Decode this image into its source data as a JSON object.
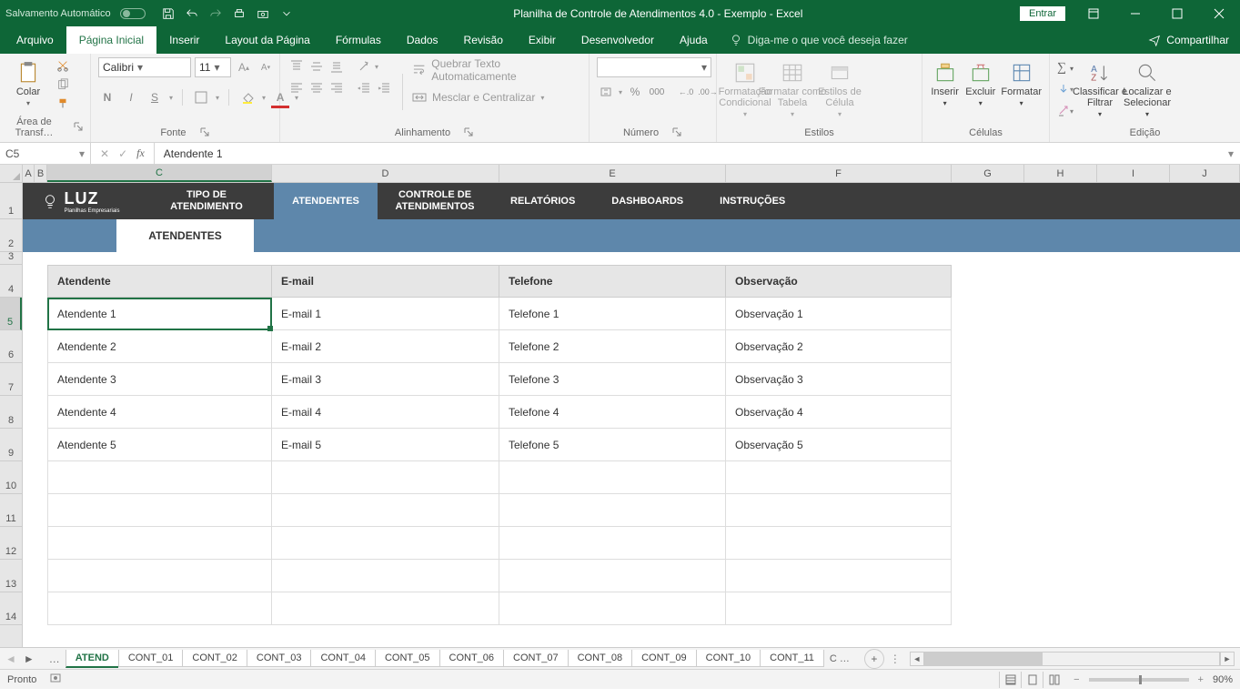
{
  "titlebar": {
    "autosave": "Salvamento Automático",
    "title": "Planilha de Controle de Atendimentos 4.0 - Exemplo  -  Excel",
    "login": "Entrar"
  },
  "tabs": {
    "arquivo": "Arquivo",
    "pagina_inicial": "Página Inicial",
    "inserir": "Inserir",
    "layout": "Layout da Página",
    "formulas": "Fórmulas",
    "dados": "Dados",
    "revisao": "Revisão",
    "exibir": "Exibir",
    "desenvolvedor": "Desenvolvedor",
    "ajuda": "Ajuda",
    "tell_me": "Diga-me o que você deseja fazer",
    "compartilhar": "Compartilhar"
  },
  "ribbon": {
    "clipboard": {
      "label": "Área de Transf…",
      "paste": "Colar"
    },
    "font": {
      "label": "Fonte",
      "name": "Calibri",
      "size": "11",
      "bold": "N",
      "italic": "I",
      "underline": "S"
    },
    "alignment": {
      "label": "Alinhamento",
      "wrap": "Quebrar Texto Automaticamente",
      "merge": "Mesclar e Centralizar"
    },
    "number": {
      "label": "Número",
      "percent": "%",
      "comma": "000",
      "dec_inc": ".0",
      "dec_dec": ".00"
    },
    "styles": {
      "label": "Estilos",
      "cond": "Formatação Condicional",
      "table": "Formatar como Tabela",
      "cell": "Estilos de Célula"
    },
    "cells": {
      "label": "Células",
      "insert": "Inserir",
      "delete": "Excluir",
      "format": "Formatar"
    },
    "editing": {
      "label": "Edição",
      "sort": "Classificar e Filtrar",
      "find": "Localizar e Selecionar"
    }
  },
  "formula": {
    "namebox": "C5",
    "value": "Atendente 1"
  },
  "columns": [
    "A",
    "B",
    "C",
    "D",
    "E",
    "F",
    "G",
    "H",
    "I",
    "J"
  ],
  "rows": [
    "1",
    "2",
    "3",
    "4",
    "5",
    "6",
    "7",
    "8",
    "9",
    "10",
    "11",
    "12",
    "13",
    "14"
  ],
  "sheetnav": {
    "brand": "LUZ",
    "brand_sub": "Planilhas Empresariais",
    "items": [
      "TIPO DE ATENDIMENTO",
      "ATENDENTES",
      "CONTROLE DE ATENDIMENTOS",
      "RELATÓRIOS",
      "DASHBOARDS",
      "INSTRUÇÕES"
    ],
    "subtab": "ATENDENTES"
  },
  "table": {
    "headers": [
      "Atendente",
      "E-mail",
      "Telefone",
      "Observação"
    ],
    "rows": [
      [
        "Atendente 1",
        "E-mail 1",
        "Telefone 1",
        "Observação 1"
      ],
      [
        "Atendente 2",
        "E-mail 2",
        "Telefone 2",
        "Observação 2"
      ],
      [
        "Atendente 3",
        "E-mail 3",
        "Telefone 3",
        "Observação 3"
      ],
      [
        "Atendente 4",
        "E-mail 4",
        "Telefone 4",
        "Observação 4"
      ],
      [
        "Atendente 5",
        "E-mail 5",
        "Telefone 5",
        "Observação 5"
      ]
    ],
    "empty_rows": 5
  },
  "sheettabs": {
    "active": "ATEND",
    "list": [
      "CONT_01",
      "CONT_02",
      "CONT_03",
      "CONT_04",
      "CONT_05",
      "CONT_06",
      "CONT_07",
      "CONT_08",
      "CONT_09",
      "CONT_10",
      "CONT_11"
    ],
    "overflow": "C"
  },
  "status": {
    "ready": "Pronto",
    "zoom": "90%"
  }
}
